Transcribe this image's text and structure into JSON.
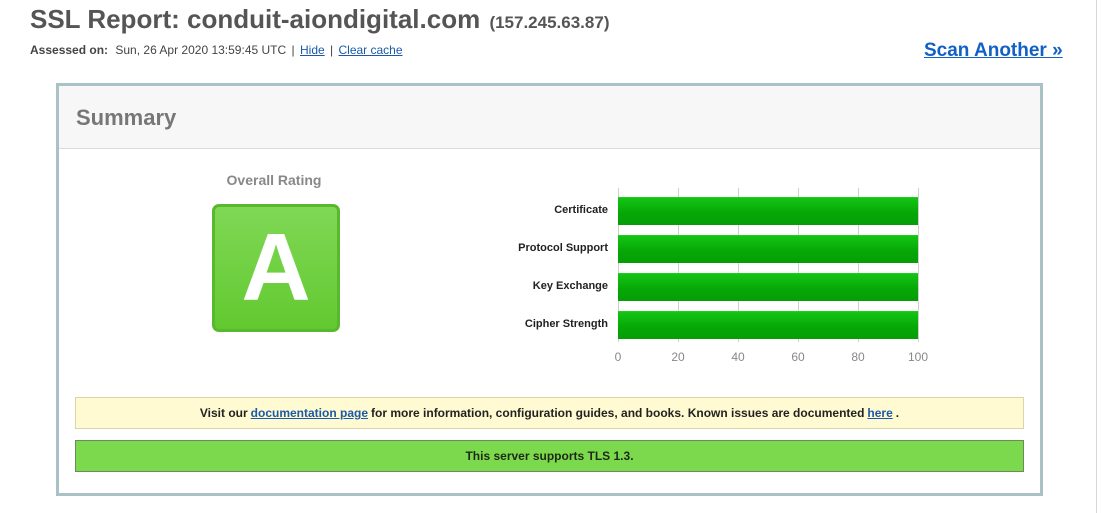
{
  "header": {
    "title": "SSL Report: conduit-aiondigital.com",
    "ip": "(157.245.63.87)",
    "assessed_label": "Assessed on:",
    "assessed_date": "Sun, 26 Apr 2020 13:59:45 UTC",
    "separator": "|",
    "hide_link": "Hide",
    "clear_cache_link": "Clear cache",
    "scan_another": "Scan Another »"
  },
  "summary": {
    "title": "Summary",
    "overall_rating_label": "Overall Rating",
    "grade": "A",
    "grade_color": "#66cc33",
    "notice": {
      "prefix": "Visit our",
      "doc_link": "documentation page",
      "middle": "for more information, configuration guides, and books. Known issues are documented",
      "here_link": "here",
      "suffix": "."
    },
    "tls_message": "This server supports TLS 1.3."
  },
  "chart_data": {
    "type": "bar",
    "orientation": "horizontal",
    "categories": [
      "Certificate",
      "Protocol Support",
      "Key Exchange",
      "Cipher Strength"
    ],
    "values": [
      100,
      100,
      100,
      100
    ],
    "xlim": [
      0,
      100
    ],
    "ticks": [
      0,
      20,
      40,
      60,
      80,
      100
    ],
    "grid": true,
    "bar_color": "#07aa07"
  }
}
